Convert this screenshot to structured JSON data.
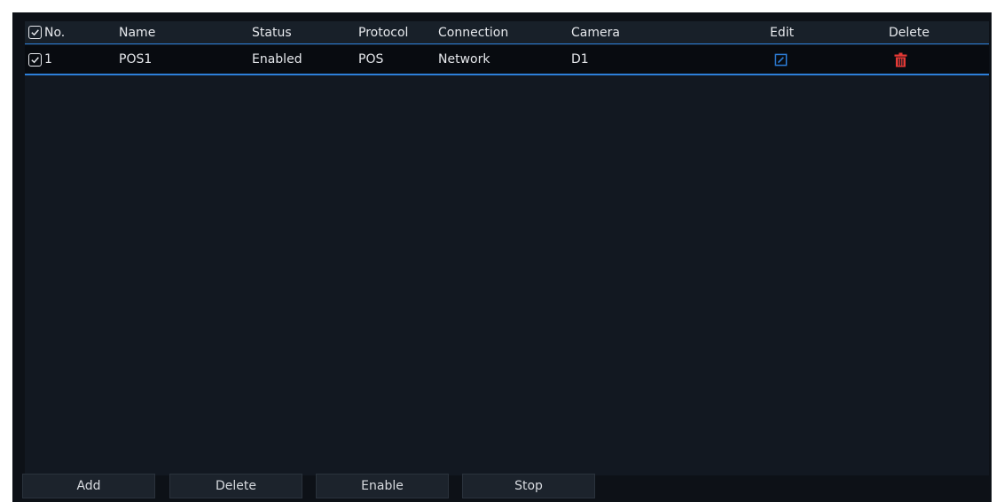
{
  "table": {
    "columns": [
      "No.",
      "Name",
      "Status",
      "Protocol",
      "Connection",
      "Camera",
      "Edit",
      "Delete"
    ],
    "rows": [
      {
        "no": "1",
        "name": "POS1",
        "status": "Enabled",
        "protocol": "POS",
        "connection": "Network",
        "camera": "D1",
        "edit_icon": "edit-icon",
        "delete_icon": "trash-icon"
      }
    ]
  },
  "toolbar": {
    "add_label": "Add",
    "delete_label": "Delete",
    "enable_label": "Enable",
    "stop_label": "Stop"
  },
  "colors": {
    "accent": "#2d7fd9",
    "delete_red": "#e53935",
    "background": "#0d1117"
  }
}
